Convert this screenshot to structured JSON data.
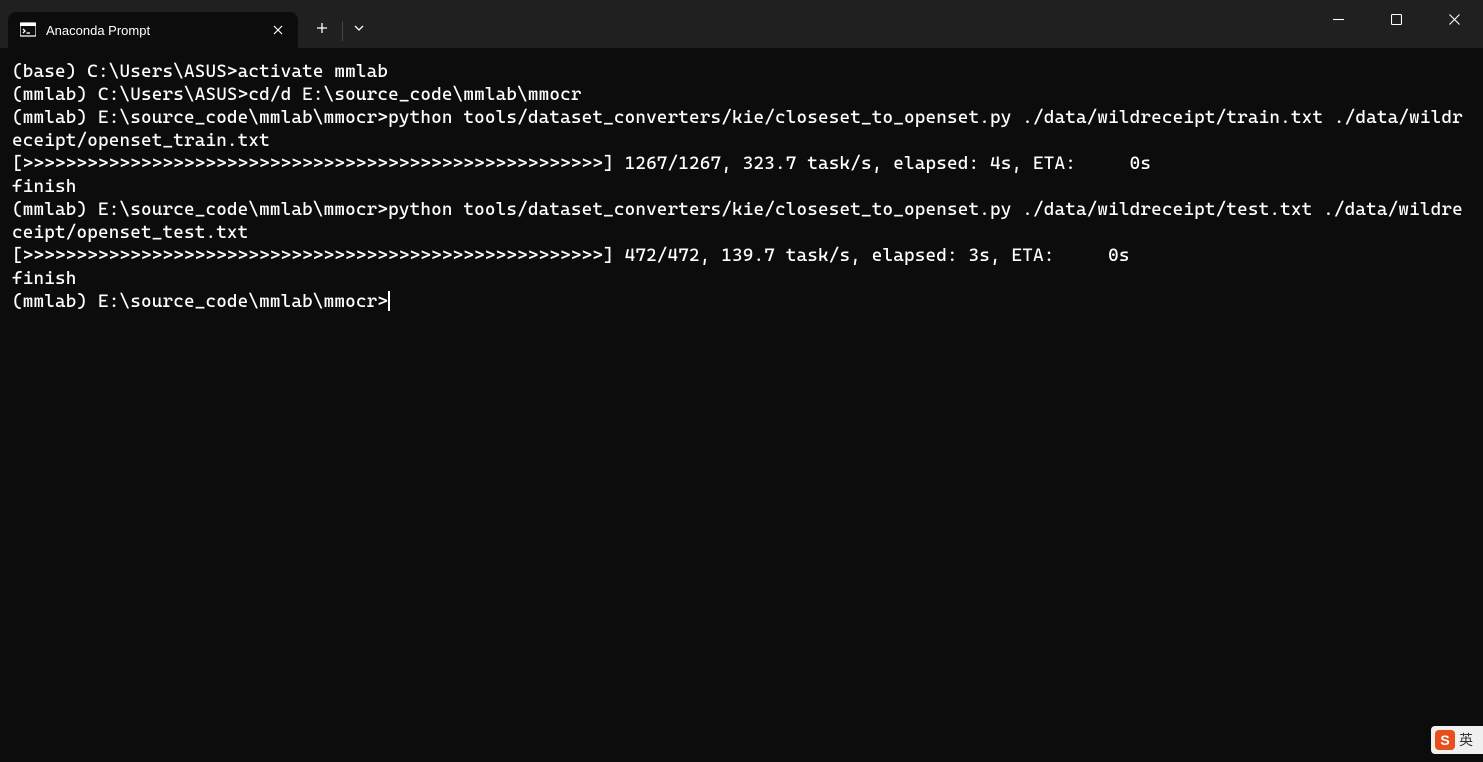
{
  "window": {
    "title": "Anaconda Prompt"
  },
  "terminal": {
    "l1": "(base) C:\\Users\\ASUS>activate mmlab",
    "blank1": "",
    "l2": "(mmlab) C:\\Users\\ASUS>cd/d E:\\source_code\\mmlab\\mmocr",
    "blank2": "",
    "l3": "(mmlab) E:\\source_code\\mmlab\\mmocr>python tools/dataset_converters/kie/closeset_to_openset.py ./data/wildreceipt/train.txt ./data/wildreceipt/openset_train.txt",
    "l4": "[>>>>>>>>>>>>>>>>>>>>>>>>>>>>>>>>>>>>>>>>>>>>>>>>>>>>>>] 1267/1267, 323.7 task/s, elapsed: 4s, ETA:     0s",
    "l5": "finish",
    "blank3": "",
    "l6": "(mmlab) E:\\source_code\\mmlab\\mmocr>python tools/dataset_converters/kie/closeset_to_openset.py ./data/wildreceipt/test.txt ./data/wildreceipt/openset_test.txt",
    "l7": "[>>>>>>>>>>>>>>>>>>>>>>>>>>>>>>>>>>>>>>>>>>>>>>>>>>>>>>] 472/472, 139.7 task/s, elapsed: 3s, ETA:     0s",
    "l8": "finish",
    "blank4": "",
    "prompt": "(mmlab) E:\\source_code\\mmlab\\mmocr>"
  },
  "ime": {
    "icon_label": "S",
    "lang": "英"
  }
}
